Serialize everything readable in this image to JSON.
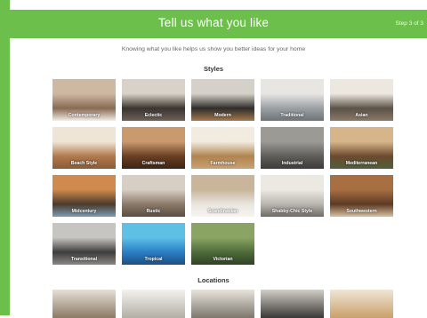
{
  "header": {
    "title": "Tell us what you like",
    "step": "Step 3 of 3",
    "color": "#6cbf4b"
  },
  "subtitle": "Knowing what you like helps us show you better ideas for your home",
  "styles": {
    "heading": "Styles",
    "items": [
      {
        "label": "Contemporary",
        "colors": [
          "#8a6a52",
          "#cdb9a2",
          "#f2ede6"
        ]
      },
      {
        "label": "Eclectic",
        "colors": [
          "#3a3430",
          "#d8d2c8",
          "#6d6257"
        ]
      },
      {
        "label": "Modern",
        "colors": [
          "#2f2d2b",
          "#d5d0c8",
          "#a4784e"
        ]
      },
      {
        "label": "Traditional",
        "colors": [
          "#9aa0a4",
          "#e7e6e2",
          "#6d7377"
        ]
      },
      {
        "label": "Asian",
        "colors": [
          "#5c5248",
          "#ece7df",
          "#8b7966"
        ]
      },
      {
        "label": "Beach Style",
        "colors": [
          "#b07a4d",
          "#efe5d6",
          "#8b5a35"
        ]
      },
      {
        "label": "Craftsman",
        "colors": [
          "#6a3f24",
          "#c99a6e",
          "#3c2414"
        ]
      },
      {
        "label": "Farmhouse",
        "colors": [
          "#b1844f",
          "#f1ebe0",
          "#c9a173"
        ]
      },
      {
        "label": "Industrial",
        "colors": [
          "#5e5d5a",
          "#9c9a95",
          "#3d3c3a"
        ]
      },
      {
        "label": "Mediterranean",
        "colors": [
          "#6b4a2e",
          "#d7b58a",
          "#4e5f3b"
        ]
      },
      {
        "label": "Midcentury",
        "colors": [
          "#4b3a2c",
          "#cf8a4d",
          "#7a9db5"
        ]
      },
      {
        "label": "Rustic",
        "colors": [
          "#8b7a6a",
          "#d8cfc4",
          "#5b4d40"
        ]
      },
      {
        "label": "Scandinavian",
        "colors": [
          "#e9e5df",
          "#c8b59a",
          "#f7f5f1"
        ]
      },
      {
        "label": "Shabby-Chic Style",
        "colors": [
          "#b9b6b0",
          "#ece9e3",
          "#6f6a63"
        ]
      },
      {
        "label": "Southwestern",
        "colors": [
          "#5c3a24",
          "#a86f43",
          "#d9c1a2"
        ]
      },
      {
        "label": "Transitional",
        "colors": [
          "#3d3d3d",
          "#c7c5c1",
          "#8a8783"
        ]
      },
      {
        "label": "Tropical",
        "colors": [
          "#2a7fc4",
          "#5fc0e6",
          "#1e4f83"
        ]
      },
      {
        "label": "Victorian",
        "colors": [
          "#4e6b3a",
          "#8aa563",
          "#2f4224"
        ]
      }
    ]
  },
  "locations": {
    "heading": "Locations",
    "items": [
      {
        "colors": [
          "#8b7a65",
          "#e6e0d6"
        ]
      },
      {
        "colors": [
          "#b2aea6",
          "#f4f2ee"
        ]
      },
      {
        "colors": [
          "#7c766d",
          "#e8e4dc"
        ]
      },
      {
        "colors": [
          "#3a3836",
          "#d3cfc8"
        ]
      },
      {
        "colors": [
          "#c9a06b",
          "#efe6d6"
        ]
      }
    ]
  }
}
